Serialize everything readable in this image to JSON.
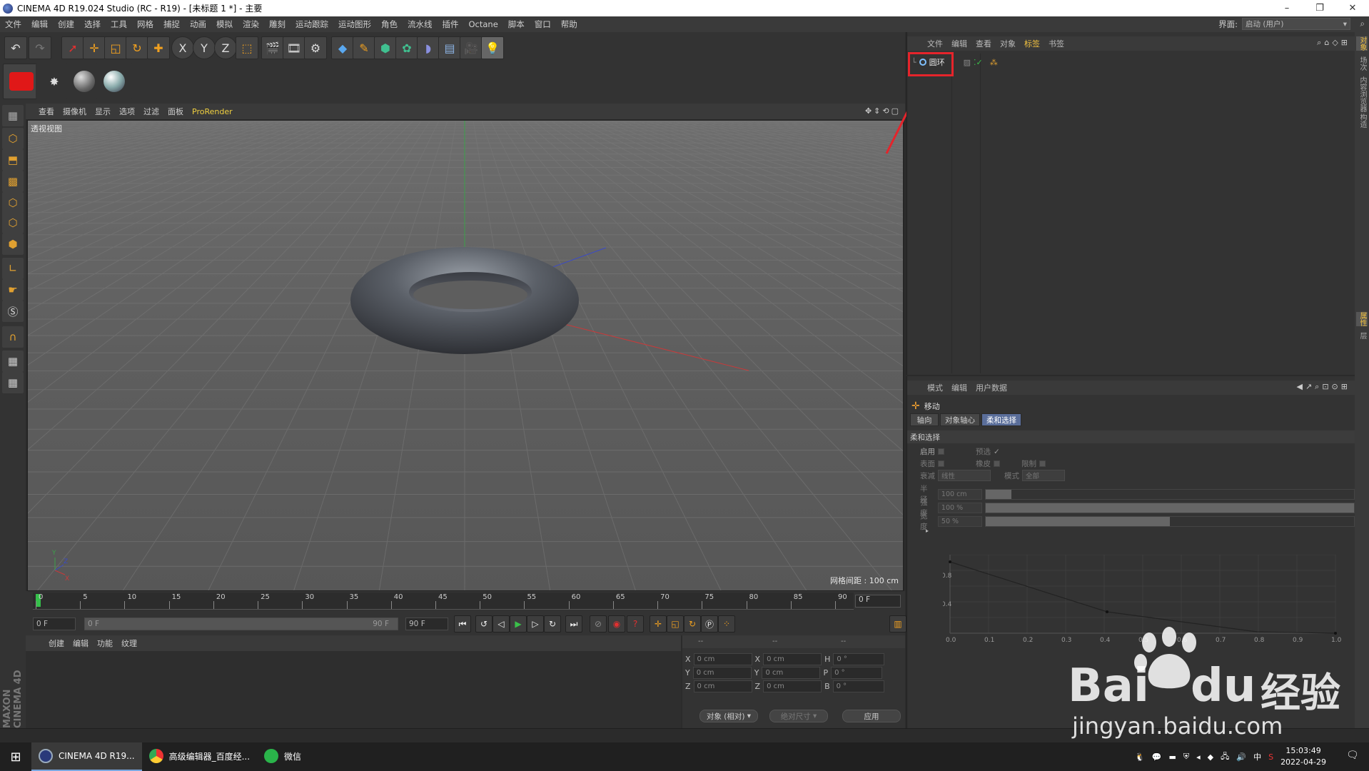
{
  "window": {
    "title": "CINEMA 4D R19.024 Studio (RC - R19) - [未标题 1 *] - 主要",
    "controls": [
      "–",
      "❐",
      "✕"
    ]
  },
  "menubar": {
    "items": [
      "文件",
      "编辑",
      "创建",
      "选择",
      "工具",
      "网格",
      "捕捉",
      "动画",
      "模拟",
      "渲染",
      "雕刻",
      "运动跟踪",
      "运动图形",
      "角色",
      "流水线",
      "插件",
      "Octane",
      "脚本",
      "窗口",
      "帮助"
    ],
    "layout_label": "界面:",
    "layout_value": "启动 (用户)"
  },
  "toolbar": {
    "axis_x": "X",
    "axis_y": "Y",
    "axis_z": "Z"
  },
  "viewport": {
    "menu": [
      "查看",
      "摄像机",
      "显示",
      "选项",
      "过滤",
      "面板"
    ],
    "prorender": "ProRender",
    "label": "透视视图",
    "grid_info": "网格间距 : 100 cm"
  },
  "timeline": {
    "ticks": [
      "0",
      "5",
      "10",
      "15",
      "20",
      "25",
      "30",
      "35",
      "40",
      "45",
      "50",
      "55",
      "60",
      "65",
      "70",
      "75",
      "80",
      "85",
      "90"
    ],
    "current_frame": "0 F",
    "start": "0 F",
    "range_start": "0 F",
    "range_end": "90 F",
    "end": "90 F"
  },
  "material_manager": {
    "menu": [
      "创建",
      "编辑",
      "功能",
      "纹理"
    ]
  },
  "coordinates": {
    "headers": [
      "--",
      "--",
      "--"
    ],
    "rows": [
      {
        "a": "X",
        "av": "0 cm",
        "b": "X",
        "bv": "0 cm",
        "c": "H",
        "cv": "0 °"
      },
      {
        "a": "Y",
        "av": "0 cm",
        "b": "Y",
        "bv": "0 cm",
        "c": "P",
        "cv": "0 °"
      },
      {
        "a": "Z",
        "av": "0 cm",
        "b": "Z",
        "bv": "0 cm",
        "c": "B",
        "cv": "0 °"
      }
    ],
    "mode": "对象 (相对)",
    "size_mode": "绝对尺寸",
    "apply": "应用"
  },
  "object_manager": {
    "menu": [
      "文件",
      "编辑",
      "查看",
      "对象",
      "标签",
      "书签"
    ],
    "active_menu": "标签",
    "objects": [
      {
        "name": "圆环"
      }
    ]
  },
  "attribute_manager": {
    "menu": [
      "模式",
      "编辑",
      "用户数据"
    ],
    "tool_name": "移动",
    "tabs": [
      "轴向",
      "对象轴心",
      "柔和选择"
    ],
    "active_tab": "柔和选择",
    "section": "柔和选择",
    "fields": {
      "enable": "启用",
      "preview": "预选",
      "surface": "表面",
      "rubber": "橡皮",
      "restrict": "限制",
      "falloff_label": "衰减",
      "falloff_value": "线性",
      "mode_label": "模式",
      "mode_value": "全部",
      "radius_label": "半径",
      "radius_value": "100 cm",
      "radius_fill": 0.07,
      "strength_label": "强度",
      "strength_value": "100 %",
      "strength_fill": 1.0,
      "width_label": "宽度",
      "width_value": "50 %",
      "width_fill": 0.5
    },
    "graph": {
      "y_ticks": [
        "0.8",
        "0.4"
      ],
      "x_ticks": [
        "0.0",
        "0.1",
        "0.2",
        "0.3",
        "0.4",
        "0.5",
        "0.6",
        "0.7",
        "0.8",
        "0.9",
        "1.0"
      ]
    }
  },
  "right_tabs": [
    "对象",
    "场次",
    "内容浏览器",
    "构造",
    "属性",
    "层"
  ],
  "taskbar": {
    "apps": [
      {
        "label": "CINEMA 4D R19...",
        "color": "#2a3a7a"
      },
      {
        "label": "高级编辑器_百度经...",
        "color": "#e8a020"
      },
      {
        "label": "微信",
        "color": "#2ab44a"
      }
    ],
    "ime": "中",
    "time": "15:03:49",
    "date": "2022-04-29"
  },
  "watermark": {
    "brand": "Bai",
    "brand2": "du",
    "cn": "经验",
    "url": "jingyan.baidu.com"
  }
}
